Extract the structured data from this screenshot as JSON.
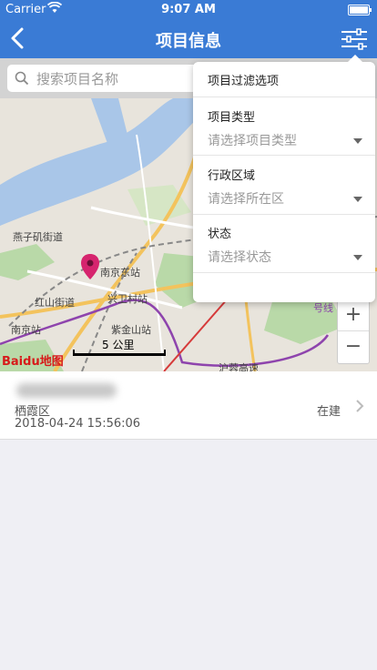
{
  "status_bar": {
    "carrier": "Carrier",
    "time": "9:07 AM"
  },
  "nav": {
    "title": "项目信息"
  },
  "search": {
    "placeholder": "搜索项目名称"
  },
  "map": {
    "labels": [
      "燕子矶街道",
      "南京东站",
      "兴卫村站",
      "红山街道",
      "南京站",
      "紫金山站",
      "沪蓉高速",
      "号线"
    ],
    "scale": "5 公里",
    "logo": "Baidu地图",
    "zoom_in": "+",
    "zoom_out": "−"
  },
  "project": {
    "district": "栖霞区",
    "date": "2018-04-24 15:56:06",
    "status": "在建"
  },
  "filter": {
    "title": "项目过滤选项",
    "type_label": "项目类型",
    "type_placeholder": "请选择项目类型",
    "region_label": "行政区域",
    "region_placeholder": "请选择所在区",
    "status_label": "状态",
    "status_placeholder": "请选择状态"
  },
  "colors": {
    "nav_bg": "#3a7bd5",
    "marker": "#d6246e"
  }
}
